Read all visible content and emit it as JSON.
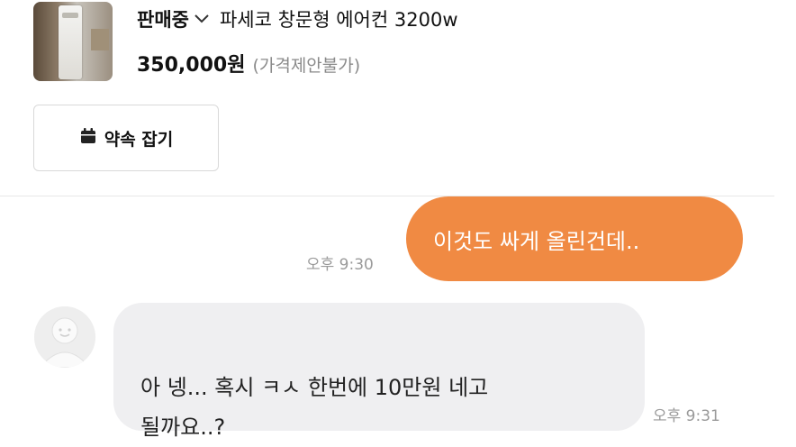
{
  "product": {
    "status": "판매중",
    "title": "파세코 창문형 에어컨 3200w",
    "price": "350,000원",
    "negotiation": "(가격제안불가)"
  },
  "actions": {
    "appointment_label": "약속 잡기"
  },
  "messages": [
    {
      "direction": "outgoing",
      "text": "이것도 싸게 올린건데..",
      "time": "오후 9:30"
    },
    {
      "direction": "incoming",
      "text": "아 넹... 혹시 ㅋㅅ 한번에 10만원 네고\n될까요..?",
      "time": "오후 9:31"
    }
  ],
  "colors": {
    "outgoing_bubble": "#f08a43",
    "incoming_bubble": "#efeff1",
    "muted_text": "#9a9a9a"
  },
  "icons": {
    "status_dropdown": "chevron-down-icon",
    "appointment": "calendar-icon",
    "avatar": "default-avatar-icon"
  }
}
